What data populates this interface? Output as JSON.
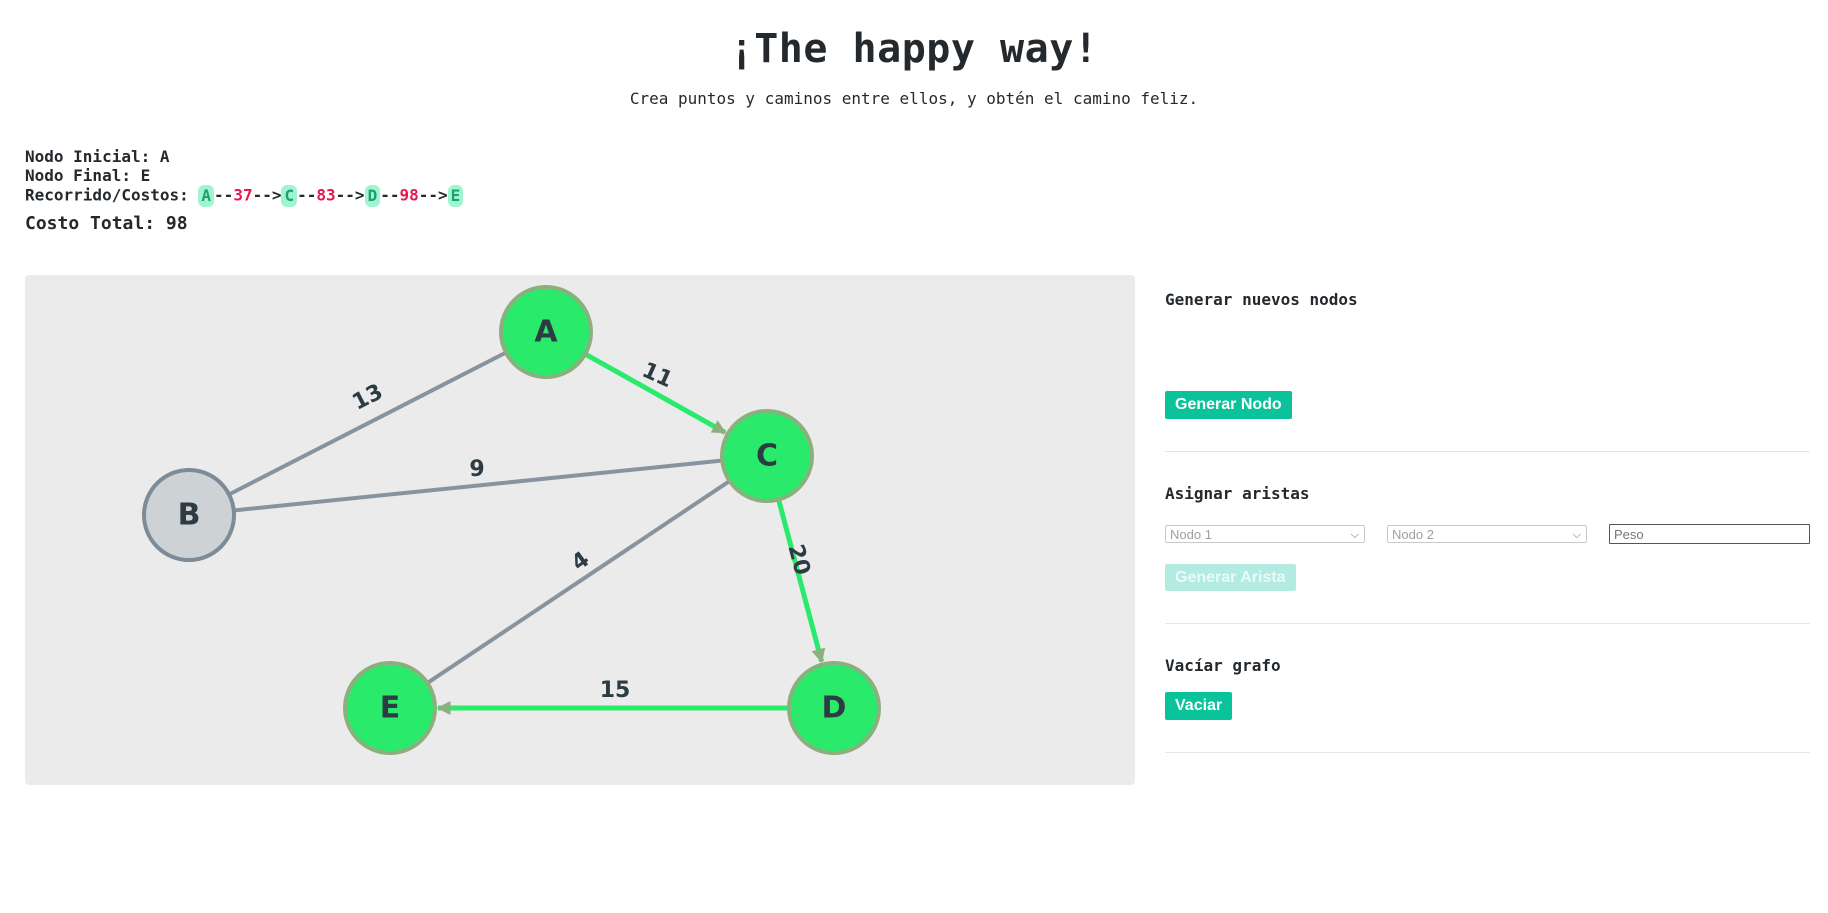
{
  "header": {
    "title": "¡The happy way!",
    "subtitle": "Crea puntos y caminos entre ellos, y obtén el camino feliz."
  },
  "info": {
    "start_label": "Nodo Inicial:",
    "start_value": "A",
    "end_label": "Nodo Final:",
    "end_value": "E",
    "route_label": "Recorrido/Costos:",
    "route": {
      "n0": "A",
      "c0": "37",
      "n1": "C",
      "c1": "83",
      "n2": "D",
      "c2": "98",
      "n3": "E",
      "sep": "--",
      "arrow": "-->"
    },
    "total_label": "Costo Total:",
    "total_value": "98"
  },
  "graph": {
    "nodes": [
      "A",
      "B",
      "C",
      "D",
      "E"
    ],
    "edges": [
      {
        "from": "A",
        "to": "C",
        "weight": "11",
        "on_path": true
      },
      {
        "from": "A",
        "to": "B",
        "weight": "13",
        "on_path": false
      },
      {
        "from": "B",
        "to": "C",
        "weight": "9",
        "on_path": false
      },
      {
        "from": "C",
        "to": "E",
        "weight": "4",
        "on_path": false
      },
      {
        "from": "C",
        "to": "D",
        "weight": "20",
        "on_path": true
      },
      {
        "from": "D",
        "to": "E",
        "weight": "15",
        "on_path": true
      }
    ],
    "colors": {
      "path_node": "#2aea6b",
      "path_node_border": "#8bb07e",
      "idle_node": "#cdd2d5",
      "idle_node_border": "#7d8b96",
      "path_edge": "#2aea6b",
      "idle_edge": "#87949f"
    }
  },
  "panel": {
    "generate_nodes": {
      "heading": "Generar nuevos nodos",
      "button": "Generar Nodo"
    },
    "edges": {
      "heading": "Asignar aristas",
      "node1_placeholder": "Nodo 1",
      "node2_placeholder": "Nodo 2",
      "weight_placeholder": "Peso",
      "button": "Generar Arista"
    },
    "clear": {
      "heading": "Vacíar grafo",
      "button": "Vaciar"
    }
  }
}
